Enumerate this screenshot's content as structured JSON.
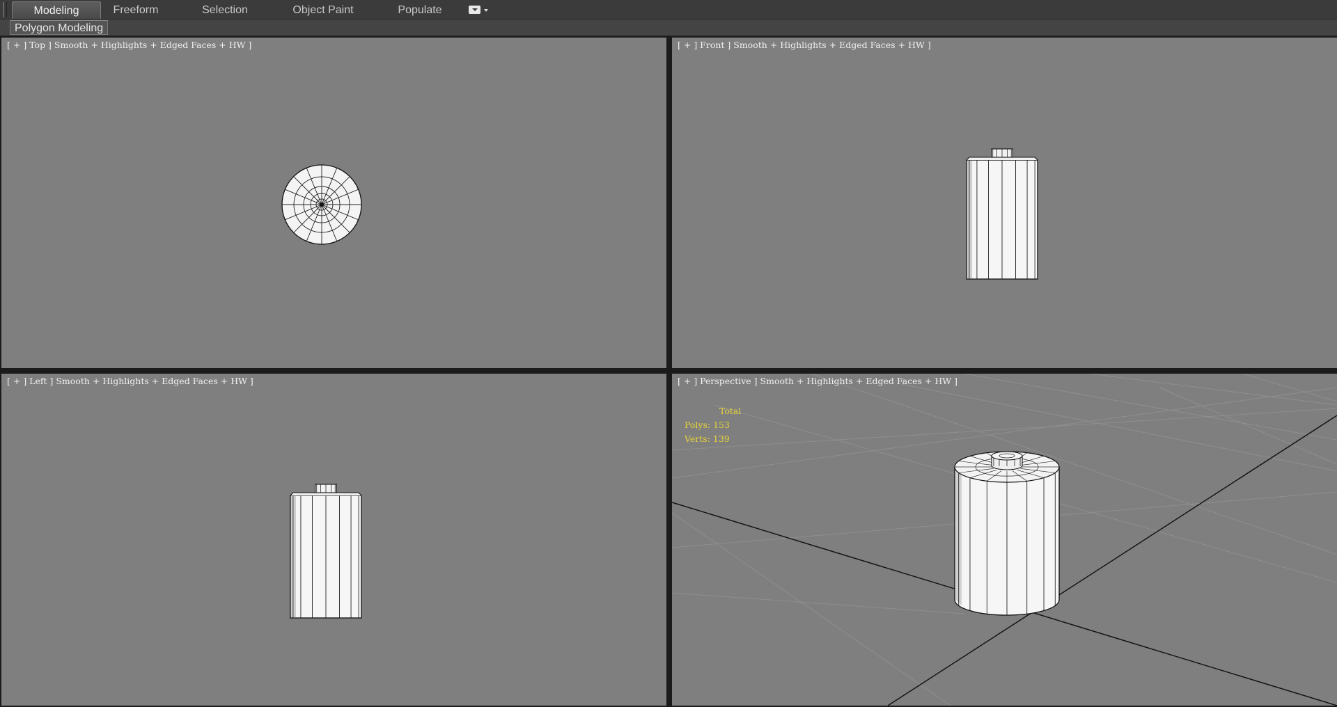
{
  "ribbon": {
    "tabs": [
      {
        "label": "Modeling",
        "active": true
      },
      {
        "label": "Freeform",
        "active": false
      },
      {
        "label": "Selection",
        "active": false
      },
      {
        "label": "Object Paint",
        "active": false
      },
      {
        "label": "Populate",
        "active": false
      }
    ],
    "panel_label": "Polygon Modeling",
    "options_icon": "ribbon-options-icon"
  },
  "viewports": {
    "top": {
      "menu_plus": "+",
      "view": "Top",
      "shading": "Smooth + Highlights + Edged Faces + HW"
    },
    "front": {
      "menu_plus": "+",
      "view": "Front",
      "shading": "Smooth + Highlights + Edged Faces + HW"
    },
    "left": {
      "menu_plus": "+",
      "view": "Left",
      "shading": "Smooth + Highlights + Edged Faces + HW"
    },
    "perspective": {
      "menu_plus": "+",
      "view": "Perspective",
      "shading": "Smooth + Highlights + Edged Faces + HW"
    }
  },
  "stats": {
    "total_label": "Total",
    "polys_label": "Polys:",
    "polys_value": "153",
    "verts_label": "Verts:",
    "verts_value": "139"
  },
  "colors": {
    "viewport_bg": "#7f7f7f",
    "stats_text": "#e6d23a",
    "active_tab": "#4f4f4f"
  }
}
